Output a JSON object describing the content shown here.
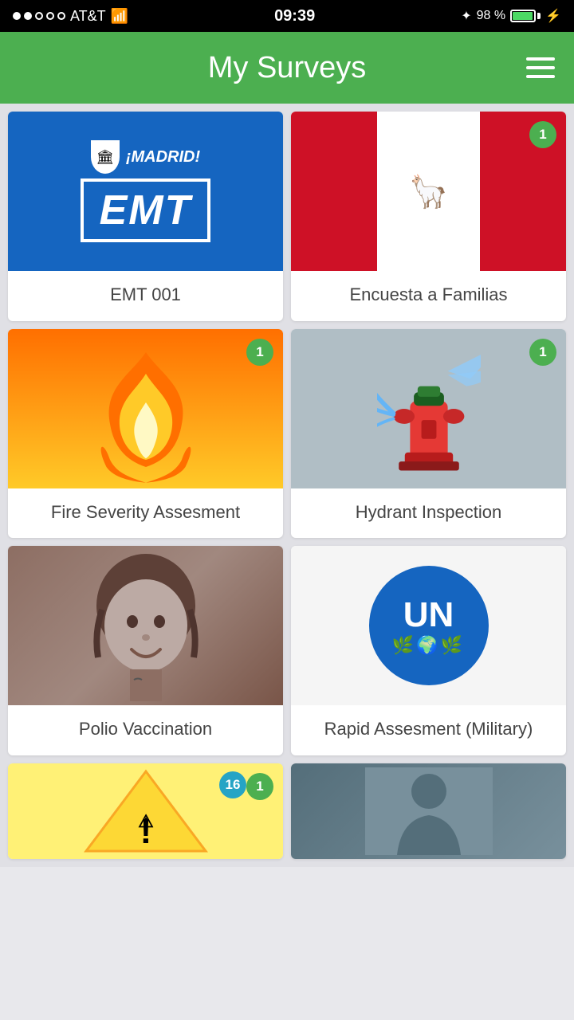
{
  "statusBar": {
    "carrier": "AT&T",
    "time": "09:39",
    "battery": "98 %"
  },
  "header": {
    "title": "My Surveys",
    "menuLabel": "Menu"
  },
  "surveys": [
    {
      "id": "emt001",
      "label": "EMT 001",
      "badge": null,
      "imageType": "emt"
    },
    {
      "id": "encuesta",
      "label": "Encuesta a Familias",
      "badge": "1",
      "badgeColor": "green",
      "imageType": "peru"
    },
    {
      "id": "fire",
      "label": "Fire Severity Assesment",
      "badge": "1",
      "badgeColor": "green",
      "imageType": "fire"
    },
    {
      "id": "hydrant",
      "label": "Hydrant Inspection",
      "badge": "1",
      "badgeColor": "green",
      "imageType": "hydrant"
    },
    {
      "id": "polio",
      "label": "Polio Vaccination",
      "badge": null,
      "imageType": "polio"
    },
    {
      "id": "rapid",
      "label": "Rapid Assesment (Military)",
      "badge": null,
      "imageType": "un"
    },
    {
      "id": "warning",
      "label": "",
      "badge": "16",
      "badgeColor": "blue",
      "badge2": "1",
      "imageType": "warning",
      "partial": true
    },
    {
      "id": "person",
      "label": "",
      "badge": null,
      "imageType": "person",
      "partial": true
    }
  ]
}
